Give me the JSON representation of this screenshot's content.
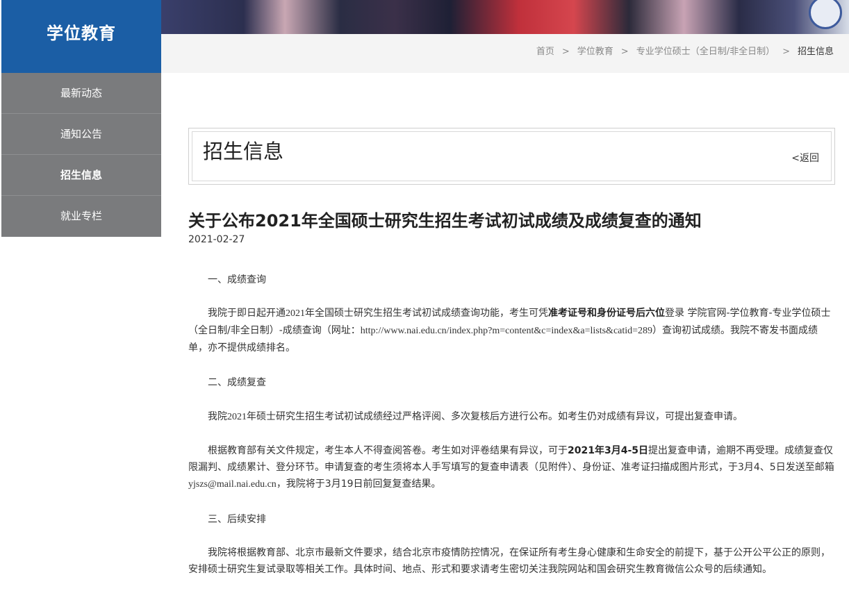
{
  "site": {
    "logo_text": "学位教育"
  },
  "breadcrumb": {
    "items": [
      "首页",
      "学位教育",
      "专业学位硕士（全日制/非全日制）",
      "招生信息"
    ],
    "separator": ">"
  },
  "sidebar": {
    "items": [
      {
        "label": "最新动态",
        "active": false
      },
      {
        "label": "通知公告",
        "active": false
      },
      {
        "label": "招生信息",
        "active": true
      },
      {
        "label": "就业专栏",
        "active": false
      }
    ]
  },
  "section": {
    "title": "招生信息",
    "back_label": "<返回"
  },
  "article": {
    "title": "关于公布2021年全国硕士研究生招生考试初试成绩及成绩复查的通知",
    "date": "2021-02-27",
    "h1": "一、成绩查询",
    "p1_a": "我院于即日起开通",
    "p1_year": "2021",
    "p1_b": "年全国硕士研究生招生考试初试成绩查询功能，考生可凭",
    "p1_bold": "准考证号和身份证号后六位",
    "p1_c": "登录 学院官网-学位教育-专业学位硕士（全日制/非全日制）-成绩查询（网址：",
    "p1_url": "http://www.nai.edu.cn/index.php?m=content&c=index&a=lists&catid=289",
    "p1_d": "）查询初试成绩。我院不寄发书面成绩单，亦不提供成绩排名。",
    "h2": "二、成绩复查",
    "p2_a": "我院",
    "p2_year": "2021",
    "p2_b": "年硕士研究生招生考试初试成绩经过严格评阅、多次复核后方进行公布。如考生仍对成绩有异议，可提出复查申请。",
    "p3_a": "根据教育部有关文件规定，考生本人不得查阅答卷。考生如对评卷结果有异议，可于",
    "p3_bold": "2021年3月4-5日",
    "p3_b": "提出复查申请，逾期不再受理。成绩复查仅限漏判、成绩累计、登分环节。申请复查的考生须将本人手写填写的复查申请表（见附件）、身份证、准考证扫描成图片形式，于3月4、5日发送至邮箱",
    "p3_email": "yjszs@mail.nai.edu.cn",
    "p3_c": "，我院将于3月19日前回复复查结果。",
    "h3": "三、后续安排",
    "p4": "我院将根据教育部、北京市最新文件要求，结合北京市疫情防控情况，在保证所有考生身心健康和生命安全的前提下，基于公开公平公正的原则，安排硕士研究生复试录取等相关工作。具体时间、地点、形式和要求请考生密切关注我院网站和国会研究生教育微信公众号的后续通知。"
  }
}
